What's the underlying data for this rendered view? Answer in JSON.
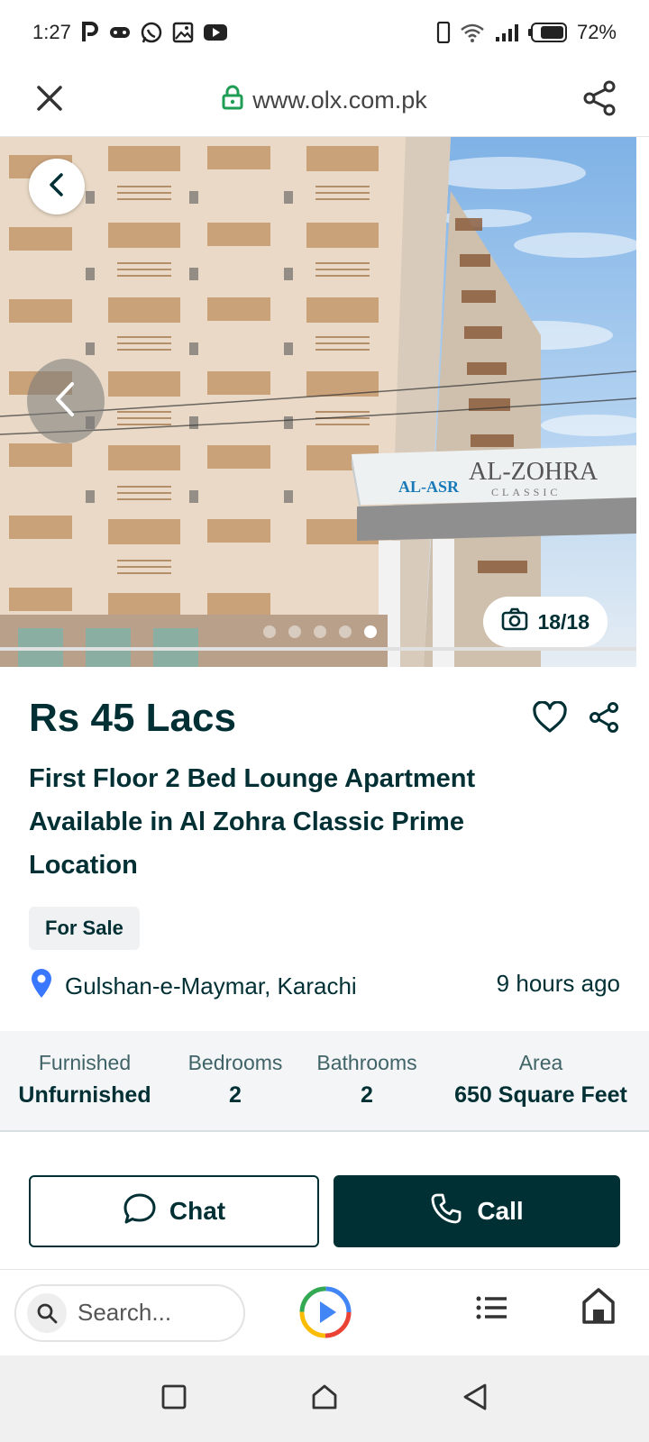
{
  "status_bar": {
    "time": "1:27",
    "battery": "72%",
    "icons": [
      "p-icon",
      "gamepad-icon",
      "whatsapp-icon",
      "gallery-icon",
      "youtube-icon",
      "phone-icon",
      "wifi-icon",
      "signal-icon",
      "battery-icon"
    ]
  },
  "browser": {
    "url": "www.olx.com.pk",
    "icons": [
      "close-icon",
      "lock-icon",
      "share-icon"
    ]
  },
  "gallery": {
    "counter": "18/18",
    "dot_count": 5,
    "active_dot": 5,
    "sign_text": "AL-ZOHRA",
    "sign_subtext": "CLASSIC",
    "logo_text": "AL-ASR"
  },
  "listing": {
    "price": "Rs 45 Lacs",
    "title_lines": [
      "First Floor 2 Bed Lounge Apartment",
      "Available in Al Zohra Classic Prime",
      "Location"
    ],
    "badge": "For Sale",
    "location": "Gulshan-e-Maymar, Karachi",
    "posted": "9 hours ago"
  },
  "specs": [
    {
      "label": "Furnished",
      "value": "Unfurnished"
    },
    {
      "label": "Bedrooms",
      "value": "2"
    },
    {
      "label": "Bathrooms",
      "value": "2"
    },
    {
      "label": "Area",
      "value": "650 Square Feet"
    }
  ],
  "actions": {
    "chat_label": "Chat",
    "call_label": "Call"
  },
  "toolbar": {
    "search_placeholder": "Search..."
  },
  "colors": {
    "brand_dark": "#002f34",
    "location_pin": "#3a77ff",
    "lock_green": "#1f9d55"
  }
}
